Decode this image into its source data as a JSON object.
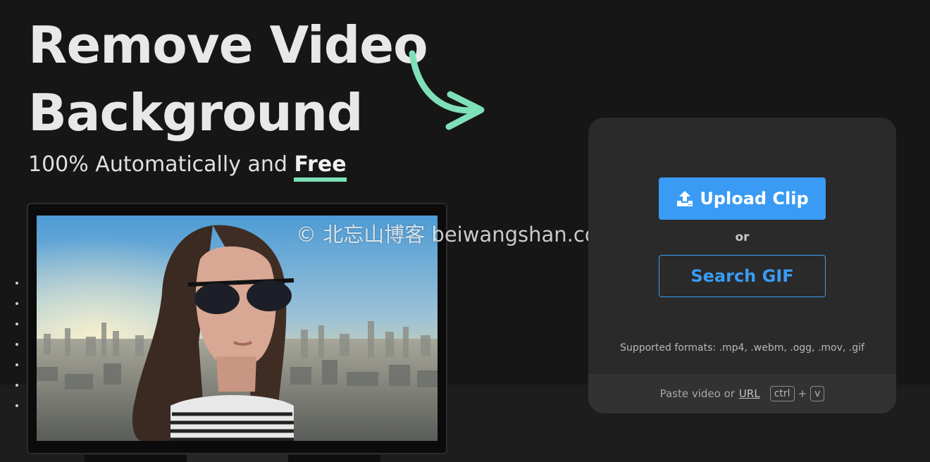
{
  "hero": {
    "title_line1": "Remove Video",
    "title_line2": "Background",
    "subtitle_prefix": "100% Automatically and ",
    "subtitle_highlight": "Free"
  },
  "watermark": "© 北忘山博客 beiwangshan.com",
  "upload_card": {
    "upload_label": "Upload Clip",
    "or_label": "or",
    "search_gif_label": "Search GIF",
    "formats_text": "Supported formats: .mp4, .webm, .ogg, .mov, .gif",
    "paste_prefix": "Paste video or",
    "paste_url_label": "URL",
    "key_ctrl": "ctrl",
    "key_plus": "+",
    "key_v": "v"
  },
  "colors": {
    "accent_blue": "#3a9bf5",
    "accent_green": "#7ee0b8",
    "background": "#161616",
    "card": "#2a2a2a"
  },
  "icons": {
    "upload": "upload-icon",
    "arrow": "curved-arrow-icon"
  }
}
